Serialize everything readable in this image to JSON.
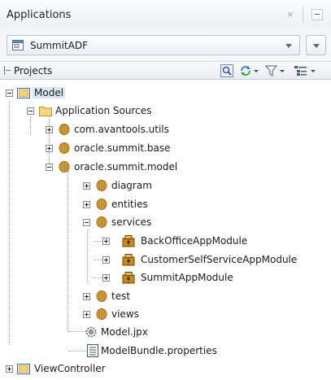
{
  "panel": {
    "title": "Applications",
    "close_glyph": "×"
  },
  "app_selector": {
    "value": "SummitADF"
  },
  "projects_bar": {
    "title": "Projects"
  },
  "tree": {
    "model": "Model",
    "application_sources": "Application Sources",
    "pkg_utils": "com.avantools.utils",
    "pkg_base": "oracle.summit.base",
    "pkg_model": "oracle.summit.model",
    "diagram": "diagram",
    "entities": "entities",
    "services": "services",
    "module_backoffice": "BackOfficeAppModule",
    "module_customer": "CustomerSelfServiceAppModule",
    "module_summit": "SummitAppModule",
    "test": "test",
    "views": "views",
    "model_jpx": "Model.jpx",
    "model_bundle": "ModelBundle.properties",
    "view_controller": "ViewController"
  },
  "colors": {
    "selection": "#dbe6f3",
    "folder": "#f3d77a",
    "package": "#d9a441",
    "module": "#c88a18",
    "project": "#4f8fd6"
  }
}
